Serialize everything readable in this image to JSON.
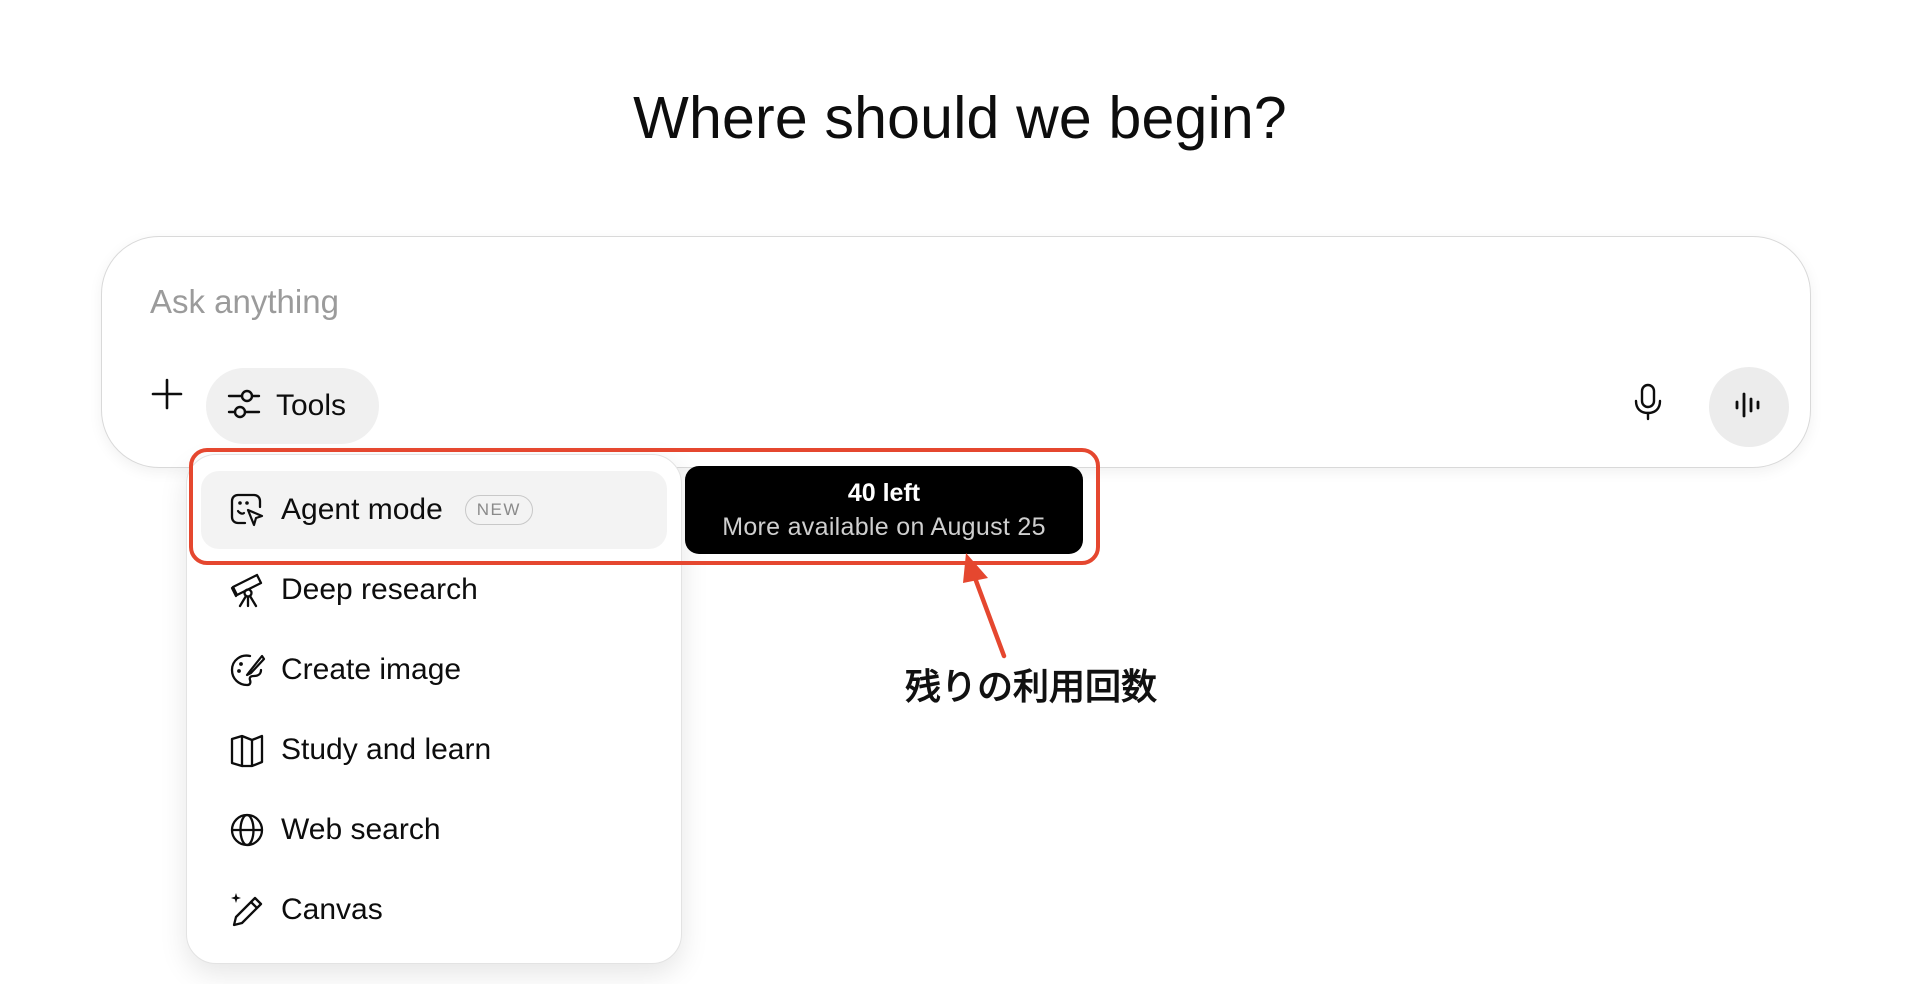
{
  "headline": "Where should we begin?",
  "composer": {
    "placeholder": "Ask anything",
    "value": "",
    "plus_icon": "plus-icon",
    "tools_label": "Tools",
    "tools_icon": "sliders-icon",
    "mic_icon": "microphone-icon",
    "voice_icon": "voice-waveform-icon"
  },
  "tools_menu": {
    "items": [
      {
        "label": "Agent mode",
        "icon": "agent-cursor-icon",
        "badge": "NEW",
        "active": true
      },
      {
        "label": "Deep research",
        "icon": "telescope-icon"
      },
      {
        "label": "Create image",
        "icon": "palette-icon"
      },
      {
        "label": "Study and learn",
        "icon": "book-icon"
      },
      {
        "label": "Web search",
        "icon": "globe-icon"
      },
      {
        "label": "Canvas",
        "icon": "pencil-sparkle-icon"
      }
    ]
  },
  "tooltip": {
    "line1": "40 left",
    "line2": "More available on August 25"
  },
  "annotation": {
    "text": "残りの利用回数",
    "color": "#e5472f"
  }
}
